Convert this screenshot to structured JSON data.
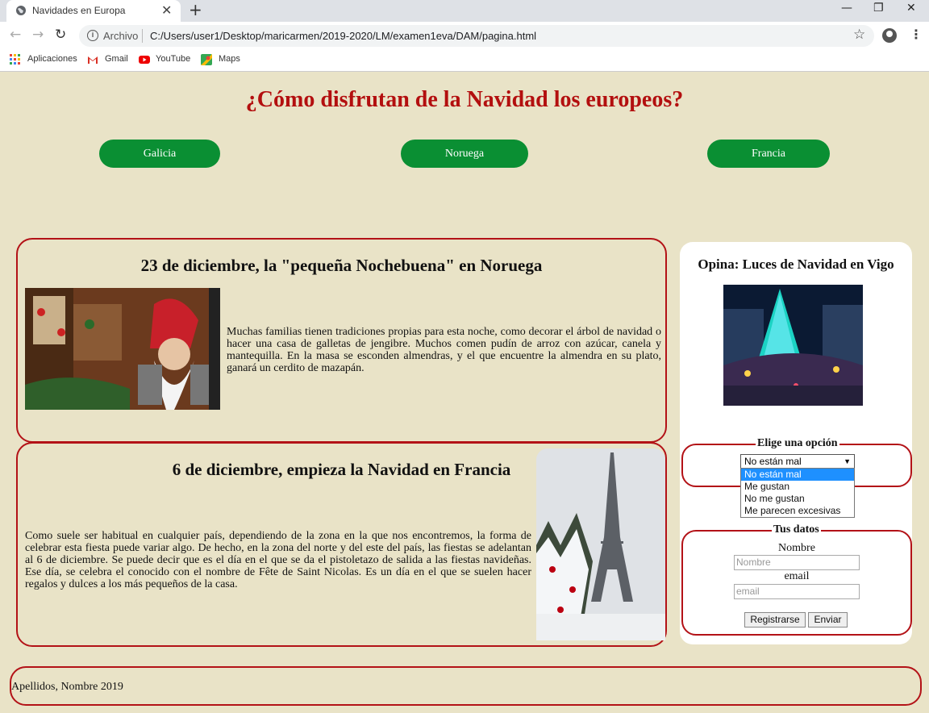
{
  "browser": {
    "tab_title": "Navidades en Europa",
    "new_tab_symbol": "+",
    "close_symbol": "✕",
    "address_label": "Archivo",
    "url": "C:/Users/user1/Desktop/maricarmen/2019-2020/LM/examen1eva/DAM/pagina.html",
    "bookmarks": [
      "Aplicaciones",
      "Gmail",
      "YouTube",
      "Maps"
    ]
  },
  "page": {
    "title": "¿Cómo disfrutan de la Navidad los europeos?",
    "nav": [
      "Galicia",
      "Noruega",
      "Francia"
    ]
  },
  "articles": [
    {
      "title": "23 de diciembre, la \"pequeña Nochebuena\" en Noruega",
      "text": "Muchas familias tienen tradiciones propias para esta noche, como decorar el árbol de navidad o hacer una casa de galletas de jengibre. Muchos comen pudín de arroz con azúcar, canela y mantequilla. En la masa se esconden almendras, y el que encuentre la almendra en su plato, ganará un cerdito de mazapán."
    },
    {
      "title": "6 de diciembre, empieza la Navidad en Francia",
      "text": "Como suele ser habitual en cualquier país, dependiendo de la zona en la que nos encontremos, la forma de celebrar esta fiesta puede variar algo. De hecho, en la zona del norte y del este del país, las fiestas se adelantan al 6 de diciembre. Se puede decir que es el día en el que se da el pistoletazo de salida a las fiestas navideñas. Ese día, se celebra el conocido con el nombre de Fête de Saint Nicolas. Es un día en el que se suelen hacer regalos y dulces a los más pequeños de la casa."
    }
  ],
  "sidebar": {
    "title": "Opina: Luces de Navidad en Vigo",
    "poll": {
      "legend": "Elige una opción",
      "selected": "No están mal",
      "options": [
        "No están mal",
        "Me gustan",
        "No me gustan",
        "Me parecen excesivas"
      ]
    },
    "form": {
      "legend": "Tus datos",
      "name_label": "Nombre",
      "name_placeholder": "Nombre",
      "email_label": "email",
      "email_placeholder": "email",
      "register_label": "Registrarse",
      "send_label": "Enviar"
    }
  },
  "footer": {
    "text": "Apellidos, Nombre 2019"
  },
  "colors": {
    "background": "#e9e3c7",
    "accent_red": "#b30f0f",
    "nav_green": "#0a8f33"
  }
}
